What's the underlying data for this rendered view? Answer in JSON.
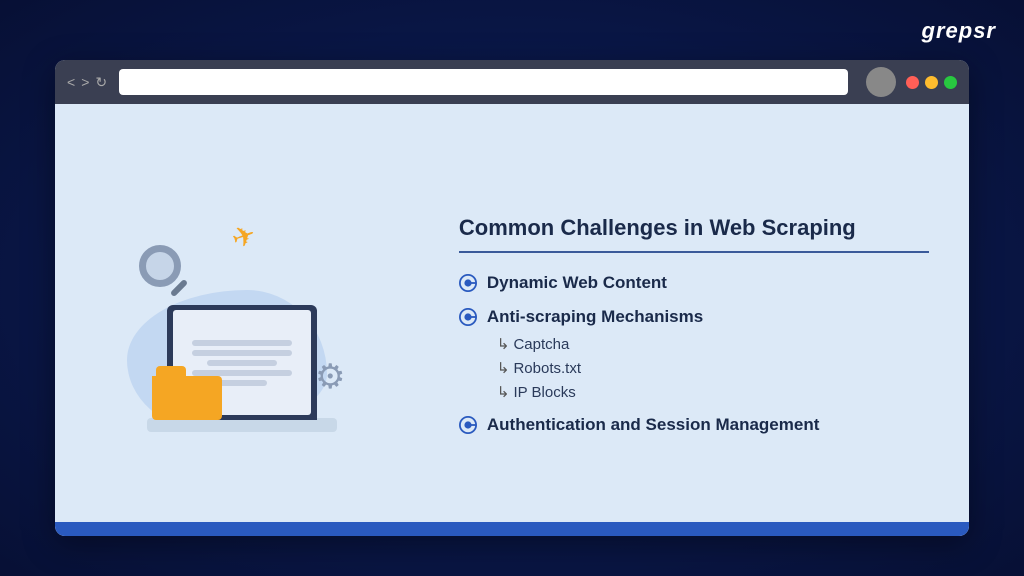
{
  "brand": {
    "logo": "grepsr"
  },
  "browser": {
    "nav": {
      "back": "<",
      "forward": ">",
      "refresh": "↻"
    },
    "window_controls": [
      "red",
      "yellow",
      "green"
    ]
  },
  "content": {
    "title": "Common Challenges in Web Scraping",
    "challenges": [
      {
        "id": "dynamic",
        "label": "Dynamic Web Content",
        "sub_items": []
      },
      {
        "id": "antiscraping",
        "label": "Anti-scraping Mechanisms",
        "sub_items": [
          "Captcha",
          "Robots.txt",
          "IP Blocks"
        ]
      },
      {
        "id": "auth",
        "label": "Authentication and Session Management",
        "sub_items": []
      }
    ],
    "sub_item_prefix": "↳"
  }
}
